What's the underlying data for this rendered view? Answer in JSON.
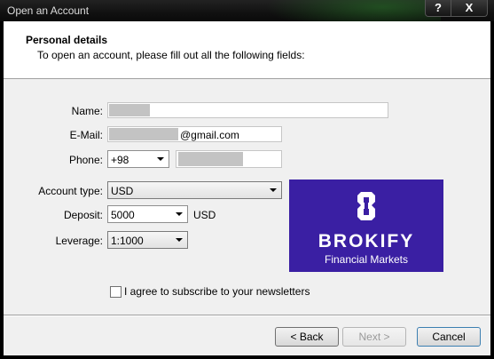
{
  "window": {
    "title": "Open an Account",
    "help_label": "?",
    "close_label": "X"
  },
  "header": {
    "title": "Personal details",
    "subtitle": "To open an account, please fill out all the following fields:"
  },
  "form": {
    "name": {
      "label": "Name:",
      "value": ""
    },
    "email": {
      "label": "E-Mail:",
      "suffix": "@gmail.com"
    },
    "phone": {
      "label": "Phone:",
      "country_code": "+98",
      "number": ""
    },
    "account_type": {
      "label": "Account type:",
      "value": "USD"
    },
    "deposit": {
      "label": "Deposit:",
      "value": "5000",
      "currency": "USD"
    },
    "leverage": {
      "label": "Leverage:",
      "value": "1:1000"
    },
    "newsletter": {
      "label": "I agree to subscribe to your newsletters",
      "checked": false
    }
  },
  "banner": {
    "brand": "BROKIFY",
    "tagline": "Financial Markets",
    "color": "#3a1fa3"
  },
  "buttons": {
    "back": "< Back",
    "next": "Next >",
    "cancel": "Cancel"
  }
}
